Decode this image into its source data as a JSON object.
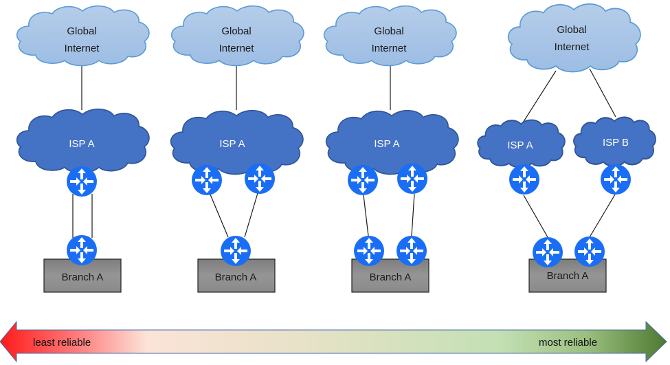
{
  "scenarios": [
    {
      "id": "single-router-dual-link",
      "internet_label": [
        "Global",
        "Internet"
      ],
      "isps": [
        {
          "label": "ISP  A"
        }
      ],
      "isp_routers": 1,
      "branch_routers": 1,
      "branch_label": "Branch A",
      "links_description": "two parallel links between one ISP router and one branch router"
    },
    {
      "id": "dual-isp-router-single-branch-router",
      "internet_label": [
        "Global",
        "Internet"
      ],
      "isps": [
        {
          "label": "ISP  A"
        }
      ],
      "isp_routers": 2,
      "branch_routers": 1,
      "branch_label": "Branch A",
      "links_description": "two ISP routers each linked to a single branch router"
    },
    {
      "id": "dual-isp-router-dual-branch-router",
      "internet_label": [
        "Global",
        "Internet"
      ],
      "isps": [
        {
          "label": "ISP  A"
        }
      ],
      "isp_routers": 2,
      "branch_routers": 2,
      "branch_label": "Branch A",
      "links_description": "two ISP routers each linked to its own branch router"
    },
    {
      "id": "dual-isp",
      "internet_label": [
        "Global",
        "Internet"
      ],
      "isps": [
        {
          "label": "ISP  A"
        },
        {
          "label": "ISP  B"
        }
      ],
      "isp_routers": 2,
      "branch_routers": 2,
      "branch_label": "Branch A",
      "links_description": "two separate ISPs, each with one router linked to its own branch router"
    }
  ],
  "reliability_scale": {
    "left_label": "least reliable",
    "right_label": "most reliable",
    "left_color": "#ff0000",
    "right_color": "#4e7a32"
  },
  "colors": {
    "internet_cloud_fill": "#a9c6e8",
    "internet_cloud_stroke": "#5b9bd5",
    "isp_cloud_fill": "#4472c4",
    "isp_cloud_stroke": "#2f5597",
    "router_fill": "#1a6ef5",
    "branch_fill": "#8a8a8a"
  },
  "icons": {
    "router": "router-icon",
    "internet": "cloud-icon",
    "isp": "cloud-icon",
    "branch": "building-box-icon"
  }
}
